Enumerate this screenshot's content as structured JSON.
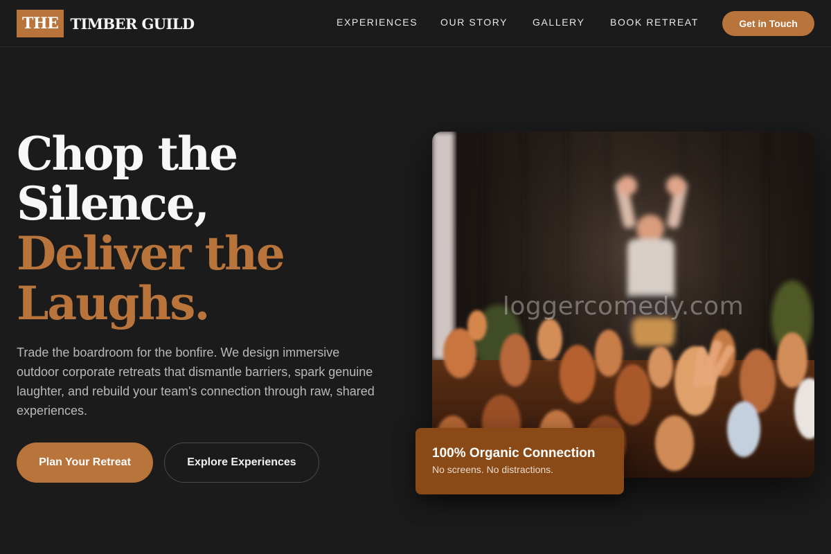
{
  "header": {
    "logo_badge": "THE",
    "logo_text": "TIMBER GUILD",
    "nav": [
      "EXPERIENCES",
      "OUR STORY",
      "GALLERY",
      "BOOK RETREAT"
    ],
    "cta": "Get in Touch"
  },
  "hero": {
    "headline_white_1": "Chop the",
    "headline_white_2": "Silence,",
    "headline_accent_1": "Deliver the",
    "headline_accent_2": "Laughs.",
    "lead": "Trade the boardroom for the bonfire. We design immersive outdoor corporate retreats that dismantle barriers, spark genuine laughter, and rebuild your team's connection through raw, shared experiences.",
    "primary_button": "Plan Your Retreat",
    "secondary_button": "Explore Experiences",
    "image_watermark": "loggercomedy.com"
  },
  "stat_card": {
    "title": "100% Organic Connection",
    "subtitle": "No screens. No distractions."
  },
  "colors": {
    "accent": "#b8743a",
    "background": "#1b1b1b",
    "card": "#8a4a17"
  }
}
